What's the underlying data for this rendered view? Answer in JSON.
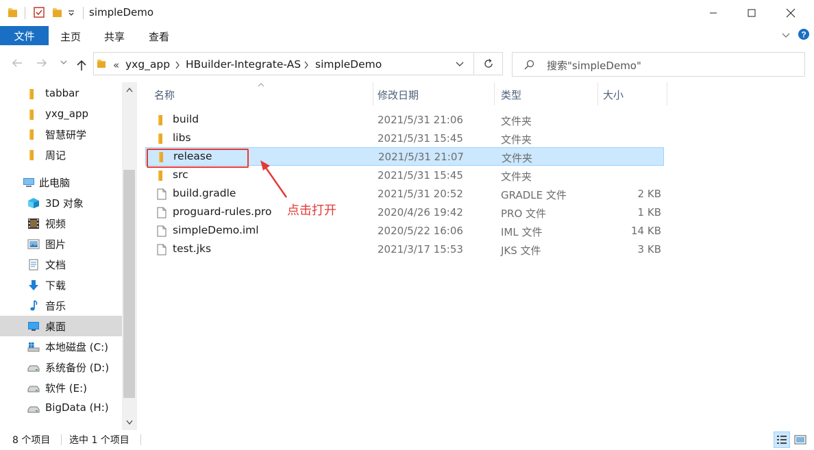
{
  "window": {
    "title": "simpleDemo",
    "controls": {
      "minimize": "minimize",
      "maximize": "maximize",
      "close": "close"
    }
  },
  "ribbon": {
    "file": "文件",
    "tabs": [
      "主页",
      "共享",
      "查看"
    ]
  },
  "address": {
    "overflow": "«",
    "crumbs": [
      "yxg_app",
      "HBuilder-Integrate-AS",
      "simpleDemo"
    ],
    "search_placeholder": "搜索\"simpleDemo\""
  },
  "nav": {
    "quick_access": [
      "tabbar",
      "yxg_app",
      "智慧研学",
      "周记"
    ],
    "this_pc": "此电脑",
    "items": [
      {
        "label": "3D 对象",
        "icon": "3d-objects-icon"
      },
      {
        "label": "视频",
        "icon": "video-icon"
      },
      {
        "label": "图片",
        "icon": "pictures-icon"
      },
      {
        "label": "文档",
        "icon": "documents-icon"
      },
      {
        "label": "下载",
        "icon": "download-icon"
      },
      {
        "label": "音乐",
        "icon": "music-icon"
      },
      {
        "label": "桌面",
        "icon": "desktop-icon",
        "selected": true
      },
      {
        "label": "本地磁盘 (C:)",
        "icon": "windows-drive-icon"
      },
      {
        "label": "系统备份 (D:)",
        "icon": "drive-icon"
      },
      {
        "label": "软件 (E:)",
        "icon": "drive-icon"
      },
      {
        "label": "BigData (H:)",
        "icon": "drive-icon"
      }
    ]
  },
  "columns": [
    "名称",
    "修改日期",
    "类型",
    "大小"
  ],
  "files": [
    {
      "name": "build",
      "date": "2021/5/31 21:06",
      "type": "文件夹",
      "size": "",
      "kind": "folder"
    },
    {
      "name": "libs",
      "date": "2021/5/31 15:45",
      "type": "文件夹",
      "size": "",
      "kind": "folder"
    },
    {
      "name": "release",
      "date": "2021/5/31 21:07",
      "type": "文件夹",
      "size": "",
      "kind": "folder",
      "selected": true
    },
    {
      "name": "src",
      "date": "2021/5/31 15:45",
      "type": "文件夹",
      "size": "",
      "kind": "folder"
    },
    {
      "name": "build.gradle",
      "date": "2021/5/31 20:52",
      "type": "GRADLE 文件",
      "size": "2 KB",
      "kind": "file"
    },
    {
      "name": "proguard-rules.pro",
      "date": "2020/4/26 19:42",
      "type": "PRO 文件",
      "size": "1 KB",
      "kind": "file"
    },
    {
      "name": "simpleDemo.iml",
      "date": "2020/5/22 16:06",
      "type": "IML 文件",
      "size": "14 KB",
      "kind": "file"
    },
    {
      "name": "test.jks",
      "date": "2021/3/17 15:53",
      "type": "JKS 文件",
      "size": "3 KB",
      "kind": "file"
    }
  ],
  "annotation": {
    "text": "点击打开",
    "color": "#e53935"
  },
  "status": {
    "count": "8 个项目",
    "selection": "选中 1 个项目"
  },
  "colors": {
    "accent": "#1a6fc4",
    "selection_bg": "#cce8ff",
    "folder": "#f5c34b"
  }
}
